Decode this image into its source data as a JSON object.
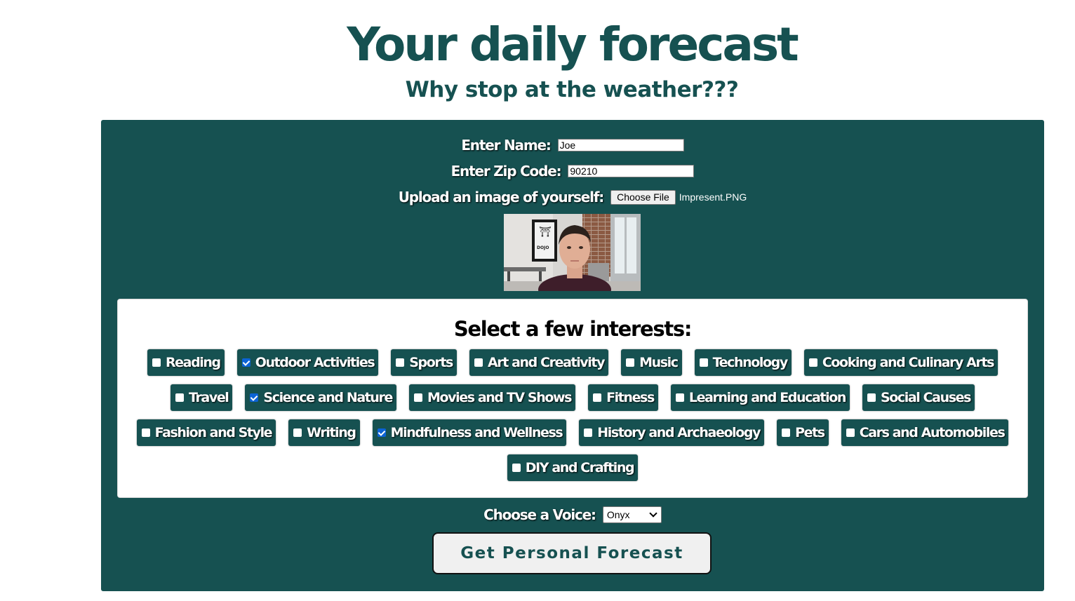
{
  "header": {
    "title": "Your daily forecast",
    "subtitle": "Why stop at the weather???"
  },
  "form": {
    "name_label": "Enter Name:",
    "name_value": "Joe",
    "zip_label": "Enter Zip Code:",
    "zip_value": "90210",
    "upload_label": "Upload an image of yourself:",
    "choose_file_label": "Choose File",
    "file_name": "Impresent.PNG"
  },
  "interests": {
    "title": "Select a few interests:",
    "rows": [
      [
        {
          "label": "Reading",
          "checked": false
        },
        {
          "label": "Outdoor Activities",
          "checked": true
        },
        {
          "label": "Sports",
          "checked": false
        },
        {
          "label": "Art and Creativity",
          "checked": false
        },
        {
          "label": "Music",
          "checked": false
        },
        {
          "label": "Technology",
          "checked": false
        },
        {
          "label": "Cooking and Culinary Arts",
          "checked": false
        }
      ],
      [
        {
          "label": "Travel",
          "checked": false
        },
        {
          "label": "Science and Nature",
          "checked": true
        },
        {
          "label": "Movies and TV Shows",
          "checked": false
        },
        {
          "label": "Fitness",
          "checked": false
        },
        {
          "label": "Learning and Education",
          "checked": false
        },
        {
          "label": "Social Causes",
          "checked": false
        }
      ],
      [
        {
          "label": "Fashion and Style",
          "checked": false
        },
        {
          "label": "Writing",
          "checked": false
        },
        {
          "label": "Mindfulness and Wellness",
          "checked": true
        },
        {
          "label": "History and Archaeology",
          "checked": false
        },
        {
          "label": "Pets",
          "checked": false
        },
        {
          "label": "Cars and Automobiles",
          "checked": false
        }
      ],
      [
        {
          "label": "DIY and Crafting",
          "checked": false
        }
      ]
    ]
  },
  "voice": {
    "label": "Choose a Voice:",
    "selected": "Onyx",
    "icon": "chevron-down-icon"
  },
  "submit": {
    "label": "Get Personal Forecast"
  },
  "colors": {
    "primary": "#165151",
    "checkbox_checked": "#0b63d6",
    "button_bg": "#f0f0f0"
  }
}
